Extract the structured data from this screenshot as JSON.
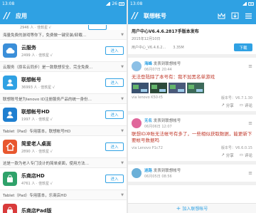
{
  "left": {
    "status": {
      "time": "13:08",
      "right": "26"
    },
    "header": {
      "logo": "//",
      "title": "应用"
    },
    "top_meta": "2946 人 · 佳软星   √",
    "rows": [
      {
        "type": "desc",
        "text": "海量免费的游戏等你下，免费做一键安装/卸载…"
      },
      {
        "type": "app",
        "name": "云服务",
        "meta": "2499 人 · 佳软星   √",
        "button": "进入",
        "icon": "cloud",
        "color": "#3b8fd9"
      },
      {
        "type": "desc",
        "text": "云服务（原名云同步）是一款联想安全、完全免费…"
      },
      {
        "type": "app",
        "name": "联想帐号",
        "meta": "36993 人 · 佳软星   √",
        "button": "进入",
        "icon": "user",
        "color": "#2fa1e3"
      },
      {
        "type": "desc",
        "text": "联想账号是为lenovo ID注册服务产品的统一身份…"
      },
      {
        "type": "app",
        "name": "联想帐号HD",
        "meta": "1997 人 · 佳软星   √",
        "button": "进入",
        "icon": "user",
        "color": "#1f7fd0"
      },
      {
        "type": "desc",
        "text": "Tablet（Pad）专用版本，联想帐号HD"
      },
      {
        "type": "app",
        "name": "简爱老人桌面",
        "meta": "2890 人 · 佳软星   √",
        "button": "进入",
        "icon": "house",
        "color": "#e8572e"
      },
      {
        "type": "desc",
        "text": "这是一款为老人专门设计的简单桌面，使用方法…"
      },
      {
        "type": "app",
        "name": "乐商店HD",
        "meta": "4761 人 · 佳软星   √",
        "button": "进入",
        "icon": "bag",
        "color": "#2fa26a"
      },
      {
        "type": "desc",
        "text": "Tablet（Pad）专用版本，乐商店HD"
      },
      {
        "type": "app",
        "name": "乐商店Pad版",
        "meta": "",
        "button": "",
        "icon": "bag",
        "color": "#d93b3b"
      }
    ]
  },
  "right": {
    "status": {
      "time": "13:08",
      "right": ""
    },
    "header": {
      "logo": "//",
      "title": "联想帐号"
    },
    "update": {
      "title": "用户中心V6.4.6.2817手版本发布",
      "date": "2015年12月10日",
      "version": "用户中心_V6.4.6.2...",
      "size": "3.35M",
      "button": "下载"
    },
    "posts": [
      {
        "user": "海峰",
        "rest": "发表到联想帐号",
        "time": "06月07日 20:44",
        "body": "无法登陆除了本号有：我不加黑名单游戏",
        "device": "via lenovo K50-t5",
        "version": "版本号：V6.7.1.30",
        "share": "分享",
        "comment": "评论",
        "avatar_color": "#8cc0e6",
        "thumbs": 4
      },
      {
        "user": "无名",
        "rest": "发表到联想帐号",
        "time": "06月06日 12:07",
        "body": "联想ID冲账无法帐号有多了，一些相似获取数据，能更新下要帐号数据吗",
        "device": "via Lenovo P1c72",
        "version": "版本号：V6.6.0.15",
        "share": "分享",
        "comment": "评论",
        "avatar_color": "#e0679b",
        "thumbs": 0
      },
      {
        "user": "迷路",
        "rest": "发表到联想帐号",
        "time": "06月05日 08:56",
        "body": "",
        "device": "",
        "version": "",
        "share": "",
        "comment": "",
        "avatar_color": "#6bb0d8",
        "thumbs": 0
      }
    ],
    "join_label": "加入联想帐号"
  },
  "colors": {
    "accent": "#2fa1e3",
    "post_text": "#c0392b"
  }
}
